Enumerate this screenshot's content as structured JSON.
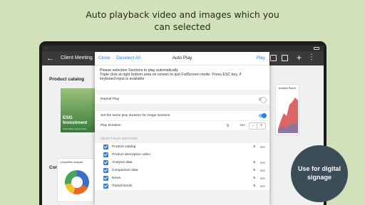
{
  "promo": {
    "line1": "Auto playback video and images which you",
    "line2": "can selected",
    "badge_line1": "Use for digital",
    "badge_line2": "signage"
  },
  "app": {
    "title": "Client Meeting"
  },
  "background": {
    "section1": "Product catalog",
    "section2": "Comparison data",
    "esg_caption": "ESG Investment",
    "esg_sub": "sustainable supply future",
    "chart_title": "Analysis Report",
    "comp_title": "Competitive analysis"
  },
  "dialog": {
    "close_label": "Close",
    "deselect_label": "Deselect All",
    "title": "Auto Play",
    "play_label": "Play",
    "instructions": [
      "Please selection Sections to play automatically",
      "Triple click at right bottom area on screen to quit FullScreen mode. Press ESC key, if",
      "keyboard input is available"
    ],
    "repeat_play_label": "Repeat Play",
    "repeat_play_on": false,
    "same_duration_label": "Set the same play duration for image sections",
    "same_duration_on": true,
    "play_duration_label": "Play Duration",
    "play_duration_value": "5",
    "play_duration_unit": "sec",
    "stepper_minus": "−",
    "stepper_plus": "+",
    "sections_header": "SELECT PLAY SECTIONS",
    "sections": [
      {
        "name": "Product catalog",
        "seconds": "5",
        "unit": "sec",
        "checked": true
      },
      {
        "name": "Product description video",
        "seconds": "",
        "unit": "",
        "checked": true
      },
      {
        "name": "Analysis data",
        "seconds": "5",
        "unit": "sec",
        "checked": true
      },
      {
        "name": "Comparison data",
        "seconds": "5",
        "unit": "sec",
        "checked": true
      },
      {
        "name": "News",
        "seconds": "5",
        "unit": "sec",
        "checked": true
      },
      {
        "name": "Global trends",
        "seconds": "5",
        "unit": "sec",
        "checked": true
      }
    ]
  },
  "colors": {
    "accent": "#2f80ed",
    "promo_background": "#d3e1ba",
    "badge": "#3b4d56"
  }
}
